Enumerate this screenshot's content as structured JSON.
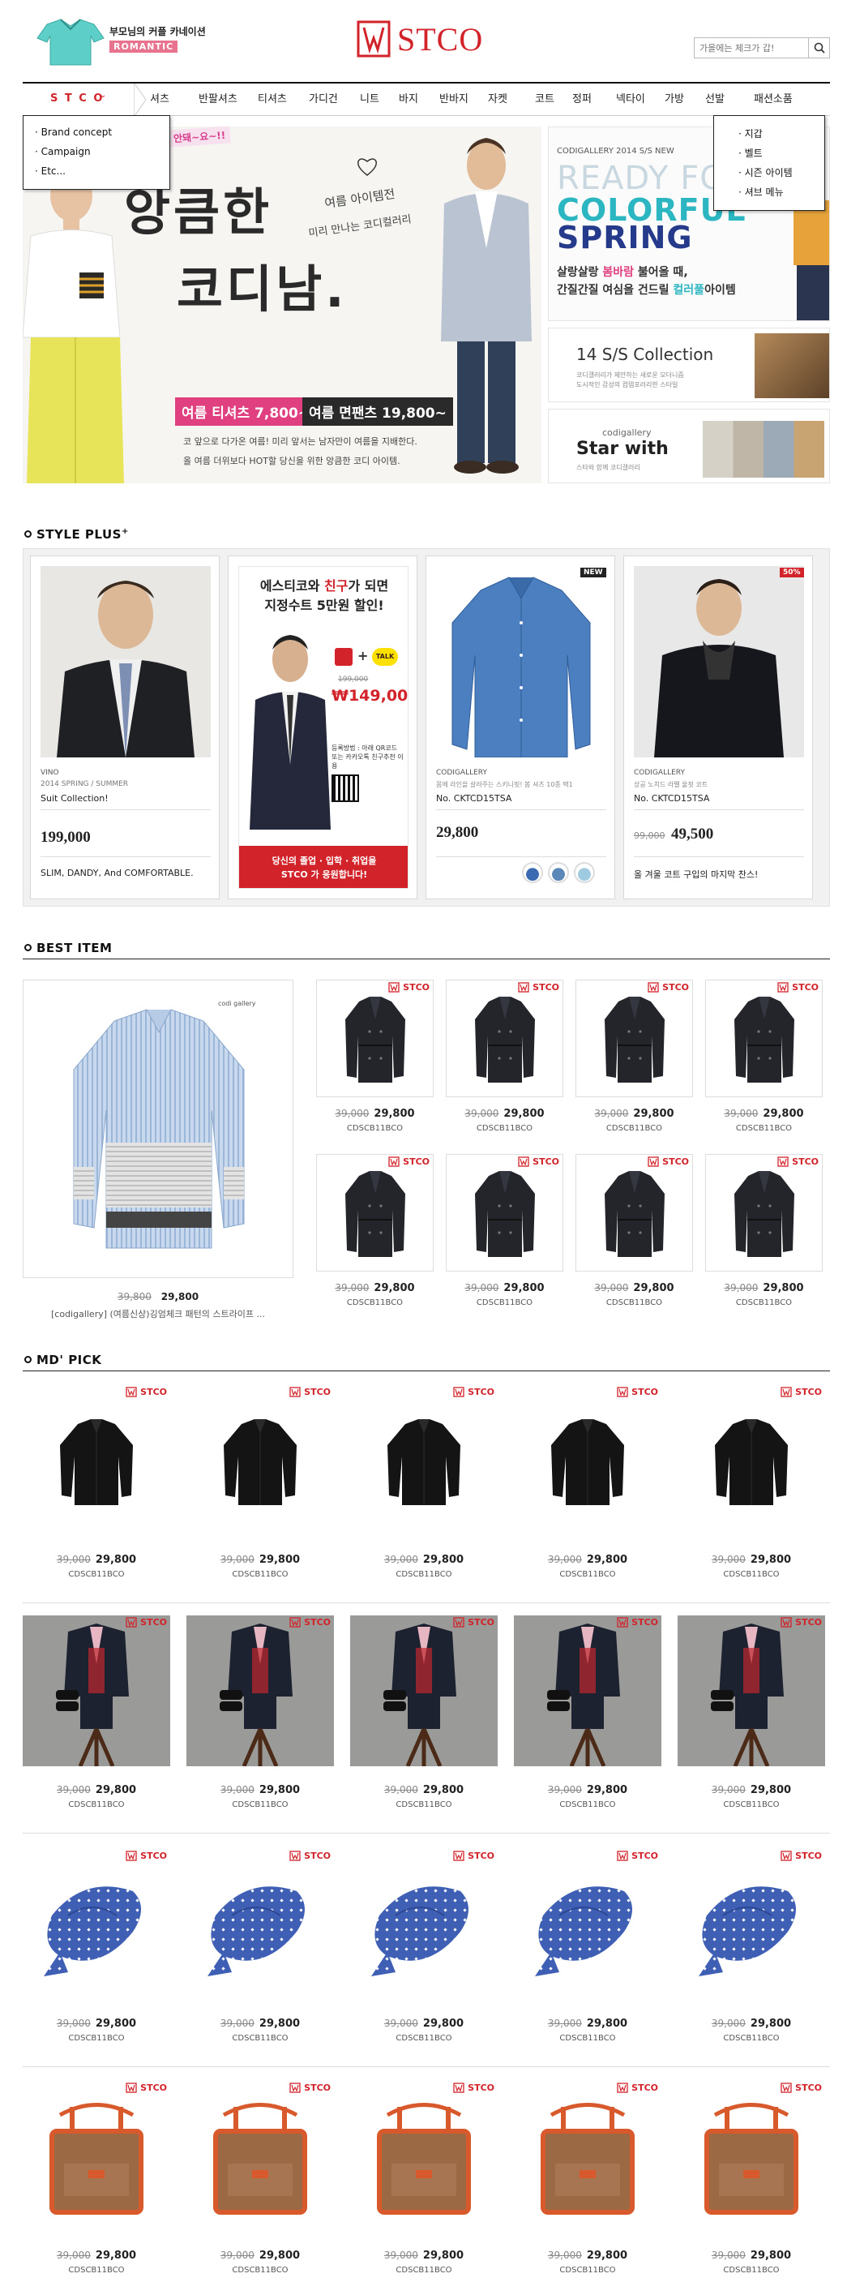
{
  "header": {
    "promo_line1": "부모님의 커플 카네이션",
    "promo_badge": "ROMANTIC",
    "logo": "STCO",
    "search_placeholder": "가을에는 체크가 갑!"
  },
  "nav": {
    "brand_menu": "S T C O",
    "items": [
      "셔츠",
      "반팔셔츠",
      "티셔츠",
      "가디건",
      "니트",
      "바지",
      "반바지",
      "자켓",
      "코트",
      "정퍼",
      "넥타이",
      "가방",
      "선발",
      "패션소품"
    ],
    "left_dropdown": [
      "· Brand concept",
      "· Campaign",
      "· Etc..."
    ],
    "right_dropdown": [
      "· 지갑",
      "· 벨트",
      "· 시즌 아이템",
      "· 셔브 메뉴"
    ]
  },
  "hero": {
    "badge": "안돼~요~!!",
    "title_line1": "앙큼한",
    "title_line2": "코디남.",
    "script_text1": "여름 아이템전",
    "script_text2": "미리 만나는 코디컬러리",
    "price_tee": "여름 티셔츠 7,800~",
    "price_pants": "여름 면팬츠 19,800~",
    "desc1": "코 앞으로 다가온 여름! 미리 앞서는 남자만이 여름을 지배한다.",
    "desc2": "올 여름 더위보다 HOT할 당신을 위한 앙큼한 코디 아이템."
  },
  "side_banners": {
    "top_small": "CODIGALLERY 2014 S/S NEW",
    "ready": "READY FOR",
    "colorful": "COLORFUL",
    "spring": "SPRING",
    "copy1_a": "살랑살랑 ",
    "copy1_b": "봄바람",
    "copy1_c": " 불어올 때,",
    "copy2_a": "간질간질 여심을 건드릴 ",
    "copy2_b": "컬러풀",
    "copy2_c": "아이템",
    "ss_title": "14 S/S Collection",
    "ss_sub1": "코디갤러리가 제안하는 새로운 모더니즘",
    "ss_sub2": "도시적인 감성의 컴템포러리한 스타일",
    "star_small": "codigallery",
    "star_title": "Star with",
    "star_sub": "스타와 함께 코디갤러리"
  },
  "style_plus": {
    "title": "STYLE PLUS",
    "cards": [
      {
        "brand": "VINO",
        "season": "2014 SPRING / SUMMER",
        "name": "Suit Collection!",
        "price": "199,000",
        "note": "SLIM, DANDY, And COMFORTABLE."
      },
      {
        "headline1_a": "에스티코와 ",
        "headline1_b": "친구",
        "headline1_c": "가 되면",
        "headline2": "지정수트 5만원 할인!",
        "plus": "+",
        "talk": "TALK",
        "old_price": "199,000",
        "new_price": "₩149,000",
        "info": "등록방법 : 아래 QR코드 또는 카카오톡 친구추천 이용",
        "cta1": "당신의 졸업 · 입학 · 취업을",
        "cta2": "STCO 가 응원합니다!"
      },
      {
        "badge": "NEW",
        "brand": "CODIGALLERY",
        "desc": "몸에 라인을 살려주는 스키니핏! 봄 셔츠 10종 택1",
        "name": "No. CKTCD15TSA",
        "price": "29,800",
        "swatches": [
          "#3a6ab0",
          "#5b86b8",
          "#9ecbe2"
        ]
      },
      {
        "badge": "50%",
        "brand": "CODIGALLERY",
        "desc": "상공 노치드 라펠 울핏 코트",
        "name": "No. CKTCD15TSA",
        "old_price": "99,000",
        "price": "49,500",
        "note": "올 겨울 코트 구입의 마지막 찬스!"
      }
    ]
  },
  "best_item": {
    "title": "BEST ITEM",
    "feature_brand": "codi gallery",
    "feature_old": "39,800",
    "feature_new": "29,800",
    "feature_desc": "[codigallery] (여름신상)깅엄체크 패턴의 스트라이프 ...",
    "grid": [
      {
        "old": "39,000",
        "new": "29,800",
        "code": "CDSCB11BCO"
      },
      {
        "old": "39,000",
        "new": "29,800",
        "code": "CDSCB11BCO"
      },
      {
        "old": "39,000",
        "new": "29,800",
        "code": "CDSCB11BCO"
      },
      {
        "old": "39,000",
        "new": "29,800",
        "code": "CDSCB11BCO"
      },
      {
        "old": "39,000",
        "new": "29,800",
        "code": "CDSCB11BCO"
      },
      {
        "old": "39,000",
        "new": "29,800",
        "code": "CDSCB11BCO"
      },
      {
        "old": "39,000",
        "new": "29,800",
        "code": "CDSCB11BCO"
      },
      {
        "old": "39,000",
        "new": "29,800",
        "code": "CDSCB11BCO"
      }
    ]
  },
  "md_pick": {
    "title": "MD' PICK",
    "item": {
      "old": "39,000",
      "new": "29,800",
      "code": "CDSCB11BCO"
    },
    "rows": [
      "shirt",
      "suit",
      "tie",
      "bag"
    ]
  },
  "stamp": "STCO"
}
